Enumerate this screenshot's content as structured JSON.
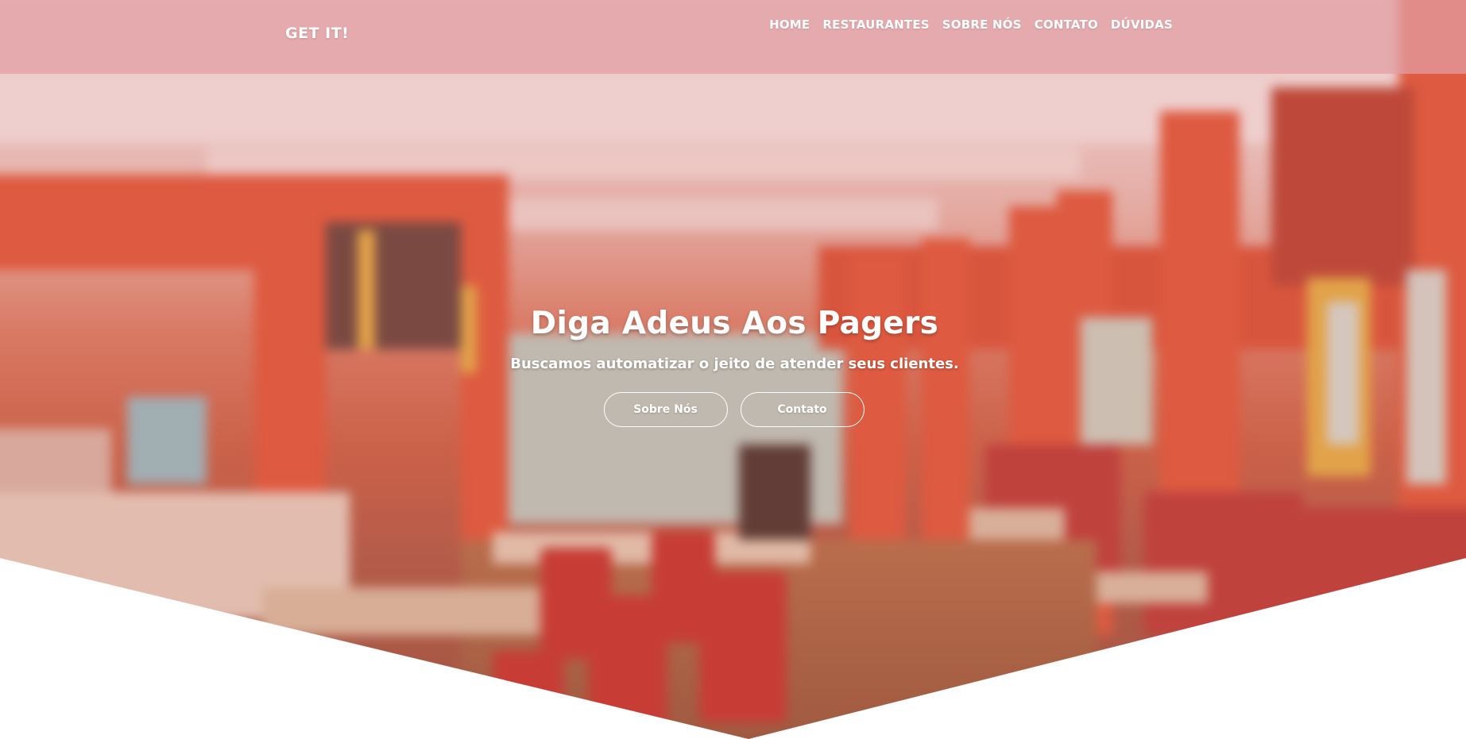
{
  "navbar": {
    "brand": "GET IT!",
    "links": [
      {
        "label": "HOME"
      },
      {
        "label": "RESTAURANTES"
      },
      {
        "label": "SOBRE NÓS"
      },
      {
        "label": "CONTATO"
      },
      {
        "label": "DÚVIDAS"
      }
    ]
  },
  "hero": {
    "title": "Diga Adeus Aos Pagers",
    "subtitle": "Buscamos automatizar o jeito de atender seus clientes.",
    "buttons": [
      {
        "label": "Sobre Nós"
      },
      {
        "label": "Contato"
      }
    ]
  },
  "colors": {
    "navbar_background": "#e2a0a5",
    "text": "#ffffff",
    "page_background": "#ffffff"
  }
}
